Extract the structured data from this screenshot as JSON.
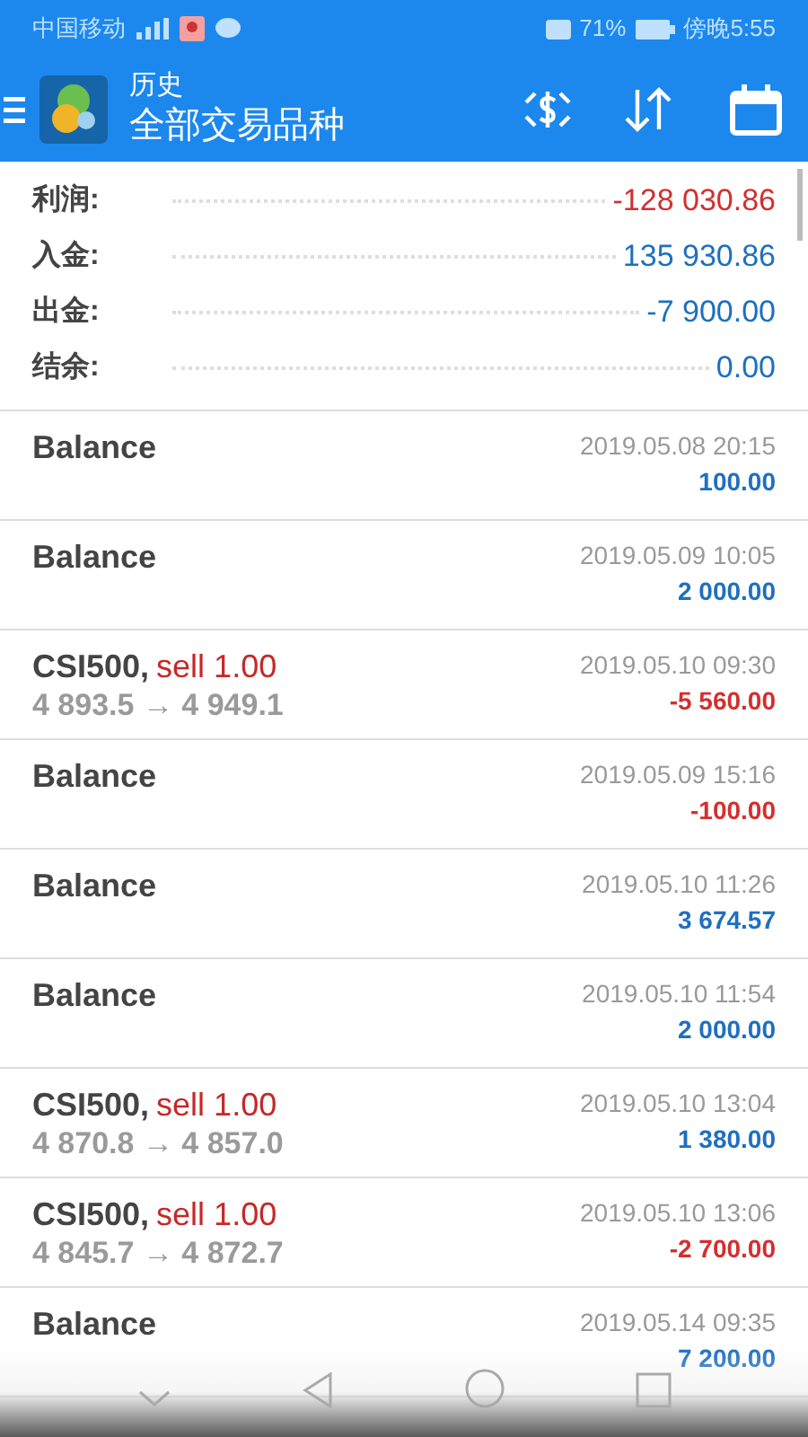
{
  "status_bar": {
    "carrier": "中国移动",
    "battery": "71%",
    "time": "傍晚5:55"
  },
  "app_bar": {
    "title": "历史",
    "subtitle": "全部交易品种"
  },
  "summary": [
    {
      "label": "利润:",
      "value": "-128 030.86",
      "color": "#d32f2f"
    },
    {
      "label": "入金:",
      "value": "135 930.86",
      "color": "#1e6fc0"
    },
    {
      "label": "出金:",
      "value": "-7 900.00",
      "color": "#1e6fc0"
    },
    {
      "label": "结余:",
      "value": "0.00",
      "color": "#1e6fc0"
    }
  ],
  "deals": [
    {
      "kind": "balance",
      "name": "Balance",
      "time": "2019.05.08 20:15",
      "profit": "100.00",
      "color": "#1e6fc0"
    },
    {
      "kind": "balance",
      "name": "Balance",
      "time": "2019.05.09 10:05",
      "profit": "2 000.00",
      "color": "#1e6fc0"
    },
    {
      "kind": "trade",
      "name": "CSI500,",
      "side": "sell 1.00",
      "prices": "4 893.5 → 4 949.1",
      "time": "2019.05.10 09:30",
      "profit": "-5 560.00",
      "color": "#d32f2f"
    },
    {
      "kind": "balance",
      "name": "Balance",
      "time": "2019.05.09 15:16",
      "profit": "-100.00",
      "color": "#d32f2f"
    },
    {
      "kind": "balance",
      "name": "Balance",
      "time": "2019.05.10 11:26",
      "profit": "3 674.57",
      "color": "#1e6fc0"
    },
    {
      "kind": "balance",
      "name": "Balance",
      "time": "2019.05.10 11:54",
      "profit": "2 000.00",
      "color": "#1e6fc0"
    },
    {
      "kind": "trade",
      "name": "CSI500,",
      "side": "sell 1.00",
      "prices": "4 870.8 → 4 857.0",
      "time": "2019.05.10 13:04",
      "profit": "1 380.00",
      "color": "#1e6fc0"
    },
    {
      "kind": "trade",
      "name": "CSI500,",
      "side": "sell 1.00",
      "prices": "4 845.7 → 4 872.7",
      "time": "2019.05.10 13:06",
      "profit": "-2 700.00",
      "color": "#d32f2f"
    },
    {
      "kind": "balance",
      "name": "Balance",
      "time": "2019.05.14 09:35",
      "profit": "7 200.00",
      "color": "#1e6fc0"
    }
  ]
}
